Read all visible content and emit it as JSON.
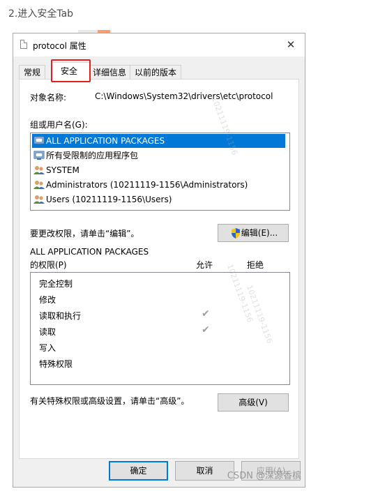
{
  "caption": "2.进入安全Tab",
  "window": {
    "title": "protocol 属性",
    "close_glyph": "✕"
  },
  "tabs": [
    {
      "label": "常规",
      "active": false
    },
    {
      "label": "安全",
      "active": true
    },
    {
      "label": "详细信息",
      "active": false
    },
    {
      "label": "以前的版本",
      "active": false
    }
  ],
  "object": {
    "label": "对象名称:",
    "value": "C:\\Windows\\System32\\drivers\\etc\\protocol"
  },
  "groups": {
    "label": "组或用户名(G):",
    "items": [
      {
        "name": "ALL APPLICATION PACKAGES",
        "icon": "packages-icon",
        "selected": true
      },
      {
        "name": "所有受限制的应用程序包",
        "icon": "packages-icon",
        "selected": false
      },
      {
        "name": "SYSTEM",
        "icon": "users-icon",
        "selected": false
      },
      {
        "name": "Administrators (10211119-1156\\Administrators)",
        "icon": "users-icon",
        "selected": false
      },
      {
        "name": "Users (10211119-1156\\Users)",
        "icon": "users-icon",
        "selected": false
      }
    ]
  },
  "edit_hint": "要更改权限，请单击“编辑”。",
  "edit_button": "编辑(E)...",
  "permissions": {
    "for_label": "ALL APPLICATION PACKAGES",
    "label": "的权限(P)",
    "allow_header": "允许",
    "deny_header": "拒绝",
    "rows": [
      {
        "name": "完全控制",
        "allow": false
      },
      {
        "name": "修改",
        "allow": false
      },
      {
        "name": "读取和执行",
        "allow": true
      },
      {
        "name": "读取",
        "allow": true
      },
      {
        "name": "写入",
        "allow": false
      },
      {
        "name": "特殊权限",
        "allow": false
      }
    ]
  },
  "advanced_hint": "有关特殊权限或高级设置，请单击“高级”。",
  "advanced_button": "高级(V)",
  "footer": {
    "ok": "确定",
    "cancel": "取消",
    "apply": "应用(A)"
  },
  "watermark_text": "10211119-1156",
  "csdn_mark": "CSDN @深源香槟",
  "colors": {
    "selection": "#0078d7",
    "highlight_border": "#e02020",
    "dialog_bg": "#f0f0f0"
  }
}
